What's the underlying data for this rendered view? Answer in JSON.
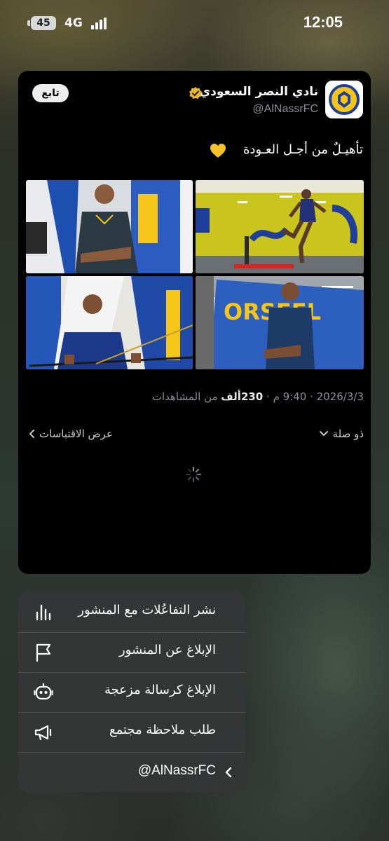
{
  "status_bar": {
    "battery": "45",
    "network": "4G",
    "time": "12:05"
  },
  "post": {
    "author_name": "نادي النصر السعودي",
    "handle": "@AlNassrFC",
    "follow_label": "تابع",
    "text": "تأهيـلٌ من أجـل العـودة",
    "date": "2026/3/3",
    "time": "9:40 م",
    "views_count": "230ألف",
    "views_label": "من المشاهدات",
    "sort_label": "ذو صلة",
    "quotes_label": "عرض الاقتباسات",
    "images": [
      {
        "name": "training-photo-jump"
      },
      {
        "name": "training-photo-arms-crossed"
      },
      {
        "name": "training-photo-stand"
      },
      {
        "name": "training-photo-pole"
      }
    ]
  },
  "menu": {
    "items": [
      {
        "label": "نشر التفاعُلات مع المنشور",
        "icon": "bar-chart-icon"
      },
      {
        "label": "الإبلاغ عن المنشور",
        "icon": "flag-icon"
      },
      {
        "label": "الإبلاغ كرسالة مزعجة",
        "icon": "robot-icon"
      },
      {
        "label": "طلب ملاحظة مجتمع",
        "icon": "megaphone-icon"
      }
    ],
    "account": "@AlNassrFC"
  },
  "colors": {
    "brand_yellow": "#f5c518",
    "brand_blue": "#1f3f9a",
    "muted": "#8b8f94"
  }
}
